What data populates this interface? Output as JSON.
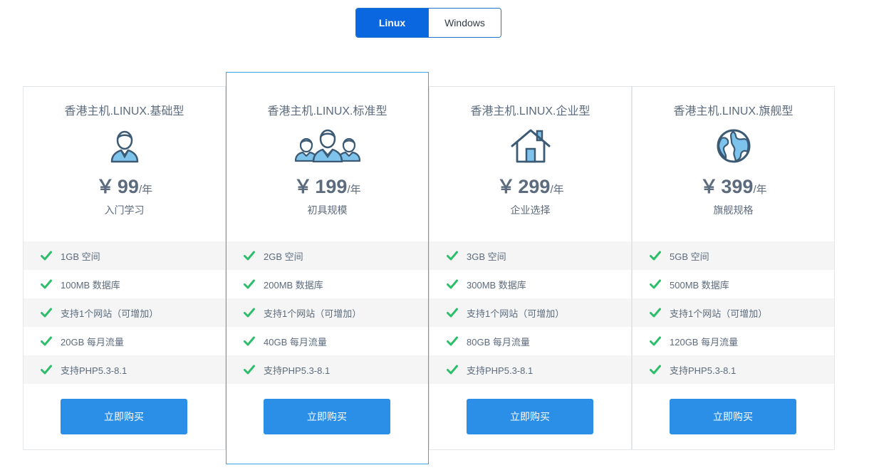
{
  "os_tabs": [
    {
      "label": "Linux",
      "active": true
    },
    {
      "label": "Windows",
      "active": false
    }
  ],
  "colors": {
    "accent": "#2b8fe8",
    "tab_active": "#0b67e0",
    "check": "#2ebd6a",
    "icon_stroke": "#3c5a74",
    "icon_fill": "#7ec3ec"
  },
  "plans": [
    {
      "title": "香港主机.LINUX.基础型",
      "icon": "user-icon",
      "currency": "￥",
      "price": "99",
      "unit": "/年",
      "desc": "入门学习",
      "features": [
        "1GB 空间",
        "100MB 数据库",
        "支持1个网站（可增加）",
        "20GB 每月流量",
        "支持PHP5.3-8.1"
      ],
      "buy_label": "立即购买"
    },
    {
      "title": "香港主机.LINUX.标准型",
      "icon": "group-icon",
      "currency": "￥",
      "price": "199",
      "unit": "/年",
      "desc": "初具规模",
      "features": [
        "2GB 空间",
        "200MB 数据库",
        "支持1个网站（可增加）",
        "40GB 每月流量",
        "支持PHP5.3-8.1"
      ],
      "buy_label": "立即购买"
    },
    {
      "title": "香港主机.LINUX.企业型",
      "icon": "house-icon",
      "currency": "￥",
      "price": "299",
      "unit": "/年",
      "desc": "企业选择",
      "features": [
        "3GB 空间",
        "300MB 数据库",
        "支持1个网站（可增加）",
        "80GB 每月流量",
        "支持PHP5.3-8.1"
      ],
      "buy_label": "立即购买"
    },
    {
      "title": "香港主机.LINUX.旗舰型",
      "icon": "globe-icon",
      "currency": "￥",
      "price": "399",
      "unit": "/年",
      "desc": "旗舰规格",
      "features": [
        "5GB 空间",
        "500MB 数据库",
        "支持1个网站（可增加）",
        "120GB 每月流量",
        "支持PHP5.3-8.1"
      ],
      "buy_label": "立即购买"
    }
  ]
}
